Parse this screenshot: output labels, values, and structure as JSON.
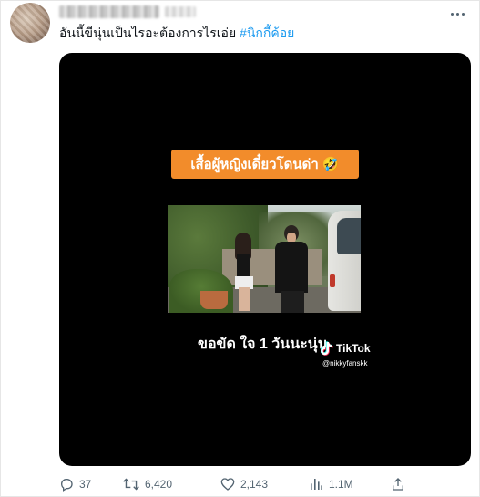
{
  "tweet": {
    "text": "อันนี้ขีนุ่นเป็นไรอะต้องการไรเอ่ย",
    "hashtag": "#นิกกี้ค้อย"
  },
  "media": {
    "caption": "เสื้อผู้หญิงเดี๋ยวโดนด่า 🤣",
    "subtitle": "ขอขัด ใจ 1 วันนะนุ่น",
    "watermark_brand": "TikTok",
    "watermark_user": "@nikkyfanskk"
  },
  "actions": {
    "replies": "37",
    "retweets": "6,420",
    "likes": "2,143",
    "views": "1.1M"
  },
  "icons": {
    "more": "more-icon",
    "reply": "reply-icon",
    "retweet": "retweet-icon",
    "like": "heart-icon",
    "views": "views-icon",
    "share": "share-icon"
  },
  "colors": {
    "hashtag": "#1d9bf0",
    "caption_badge": "#f28c2b",
    "action_icon": "#536471",
    "media_background": "#000000"
  }
}
